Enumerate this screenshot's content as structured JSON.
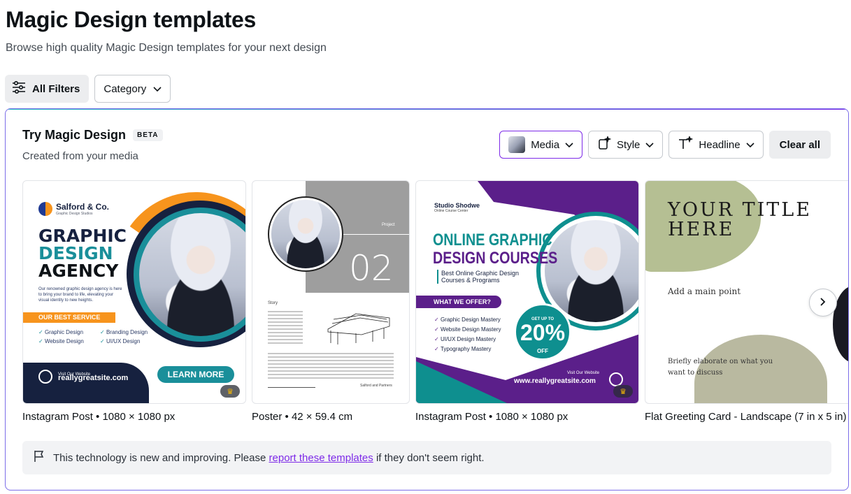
{
  "page": {
    "title": "Magic Design templates",
    "subtitle": "Browse high quality Magic Design templates for your next design"
  },
  "filters": {
    "all_filters_label": "All Filters",
    "category_label": "Category"
  },
  "magic_panel": {
    "title": "Try Magic Design",
    "badge": "BETA",
    "subtitle": "Created from your media",
    "controls": {
      "media_label": "Media",
      "style_label": "Style",
      "headline_label": "Headline",
      "clear_label": "Clear all"
    },
    "cards": [
      {
        "caption": "Instagram Post • 1080 × 1080 px",
        "brand": "Salford & Co.",
        "brand_tag": "Graphic Design Studios",
        "headline_1": "GRAPHIC",
        "headline_2": "DESIGN",
        "headline_3": "AGENCY",
        "paragraph": "Our renowned graphic design agency is here to bring your brand to life, elevating your visual identity to new heights.",
        "service_label": "OUR BEST SERVICE",
        "services": [
          "Graphic Design",
          "Branding Design",
          "Website Design",
          "UI/UX Design"
        ],
        "visit_label": "Visit Our Website",
        "url": "reallygreatsite.com",
        "cta": "LEARN MORE",
        "premium": true
      },
      {
        "caption": "Poster • 42 × 59.4 cm",
        "project_label": "Project",
        "number": "02",
        "story_label": "Story",
        "signature": "Salford and Partners"
      },
      {
        "caption": "Instagram Post • 1080 × 1080 px",
        "brand": "Studio Shodwe",
        "brand_tag": "Online Course Center",
        "headline_1": "ONLINE GRAPHIC",
        "headline_2": "DESIGN COURSES",
        "sub_1": "Best Online Graphic Design",
        "sub_2": "Courses & Programs",
        "offer_label": "WHAT WE OFFER?",
        "offers": [
          "Graphic Design Mastery",
          "Website Design Mastery",
          "UI/UX Design Mastery",
          "Typography Mastery"
        ],
        "badge_top": "GET UP TO",
        "badge_pct": "20%",
        "badge_off": "OFF",
        "visit_label": "Visit Our Website",
        "url": "www.reallygreatsite.com",
        "premium": true
      },
      {
        "caption": "Flat Greeting Card - Landscape (7 in x 5 in) •",
        "title_1": "YOUR TITLE",
        "title_2": "HERE",
        "main_point": "Add a main point",
        "elaborate_1": "Briefly elaborate on what you",
        "elaborate_2": "want to discuss"
      }
    ]
  },
  "notice": {
    "before": "This technology is new and improving. Please",
    "link": "report these templates",
    "after": "if they don't seem right."
  },
  "colors": {
    "accent": "#7d2ae8",
    "teal": "#1a8f9a",
    "orange": "#f7941d",
    "navy": "#16213f"
  }
}
